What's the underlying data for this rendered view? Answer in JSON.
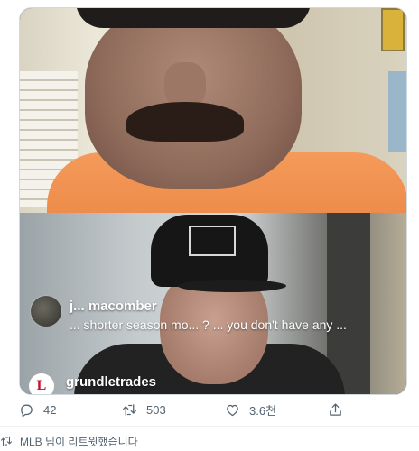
{
  "media": {
    "comment": {
      "username": "j... macomber",
      "text": "... shorter season mo... ? ... you don't have any ..."
    },
    "live_badge_glyph": "L",
    "live_username": "grundletrades"
  },
  "actions": {
    "reply_count": "42",
    "retweet_count": "503",
    "like_count": "3.6천",
    "reply_icon": "reply-icon",
    "retweet_icon": "retweet-icon",
    "like_icon": "heart-icon",
    "share_icon": "share-icon"
  },
  "retweet_notice": {
    "icon": "retweet-icon",
    "text": "MLB 님이 리트윗했습니다"
  },
  "colors": {
    "muted_text": "#536471",
    "border": "#cfd9de",
    "live_red": "#c8102e"
  }
}
